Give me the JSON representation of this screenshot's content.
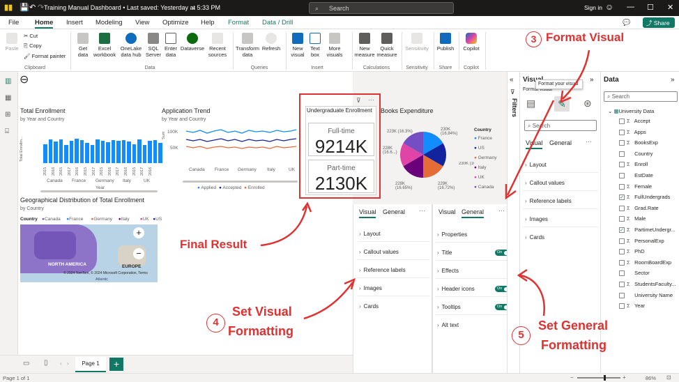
{
  "titlebar": {
    "title": "Training Manual Dashboard • Last saved: Yesterday at 5:33 PM",
    "search": "Search",
    "signin": "Sign in"
  },
  "menu": [
    "File",
    "Home",
    "Insert",
    "Modeling",
    "View",
    "Optimize",
    "Help",
    "Format",
    "Data / Drill"
  ],
  "share": "Share",
  "ribbon": {
    "clipboard": {
      "paste": "Paste",
      "cut": "Cut",
      "copy": "Copy",
      "format_painter": "Format painter",
      "label": "Clipboard"
    },
    "data": {
      "items": [
        "Get data",
        "Excel workbook",
        "OneLake data hub",
        "SQL Server",
        "Enter data",
        "Dataverse",
        "Recent sources"
      ],
      "label": "Data"
    },
    "queries": {
      "items": [
        "Transform data",
        "Refresh"
      ],
      "label": "Queries"
    },
    "insert": {
      "items": [
        "New visual",
        "Text box",
        "More visuals"
      ],
      "label": "Insert"
    },
    "calculations": {
      "items": [
        "New measure",
        "Quick measure"
      ],
      "label": "Calculations"
    },
    "sensitivity": {
      "items": [
        "Sensitivity"
      ],
      "label": "Sensitivity"
    },
    "share": {
      "items": [
        "Publish"
      ],
      "label": "Share"
    },
    "copilot": {
      "items": [
        "Copilot"
      ],
      "label": "Copilot"
    }
  },
  "visuals": {
    "enrollment": {
      "title": "Total Enrollment",
      "subtitle": "by Year and Country",
      "ylabel": "Total Enrollm...",
      "xlabel": "Year",
      "countries": [
        "Canada",
        "France",
        "Germany",
        "Italy",
        "UK"
      ],
      "years": [
        "2015",
        "2016",
        "2015",
        "2017",
        "2016",
        "2015",
        "2017",
        "2015",
        "2016",
        "2017",
        "2016",
        "2015",
        "2017",
        "2016"
      ]
    },
    "trend": {
      "title": "Application Trend",
      "subtitle": "by Year and Country",
      "ylabel": "Sum",
      "yticks": [
        "100K",
        "50K"
      ],
      "countries": [
        "Canada",
        "France",
        "Germany",
        "Italy",
        "UK"
      ],
      "legend": [
        "Applied",
        "Accepted",
        "Enrolled"
      ],
      "legend_colors": [
        "#118dff",
        "#12239e",
        "#e66c37"
      ]
    },
    "card": {
      "title": "Undergraduate Enrollment",
      "label1": "Full-time",
      "value1": "9214K",
      "label2": "Part-time",
      "value2": "2130K"
    },
    "books": {
      "title": "Books Expenditure",
      "legend_title": "Country",
      "legend": [
        "France",
        "US",
        "Germany",
        "Italy",
        "UK",
        "Canada"
      ],
      "legend_colors": [
        "#118dff",
        "#12239e",
        "#e66c37",
        "#6b007b",
        "#e044a7",
        "#744ec2"
      ],
      "labels": [
        "223K (16.3%)",
        "230K (16.84%)",
        "228K (16.6...)",
        "230K (16.…)",
        "228K (16.65%)",
        "229K (16.72%)"
      ]
    },
    "map": {
      "title": "Geographical Distribution of Total Enrollment",
      "subtitle": "by Country",
      "legend_title": "Country",
      "legend": [
        "Canada",
        "France",
        "Germany",
        "Italy",
        "UK",
        "US"
      ],
      "legend_colors": [
        "#744ec2",
        "#118dff",
        "#e66c37",
        "#6b007b",
        "#e044a7",
        "#12239e"
      ],
      "labels": [
        "NORTH AMERICA",
        "EUROPE",
        "Atlantic"
      ],
      "credit": "© 2024 TomTom, © 2024 Microsoft Corporation, Terms"
    }
  },
  "annotations": {
    "final": "Final Result",
    "step3_num": "3",
    "step3": "Format Visual",
    "step4_num": "4",
    "step4a": "Set Visual",
    "step4b": "Formatting",
    "step5_num": "5",
    "step5a": "Set General",
    "step5b": "Formatting"
  },
  "visual_pane_left": {
    "tabs": [
      "Visual",
      "General"
    ],
    "items": [
      "Layout",
      "Callout values",
      "Reference labels",
      "Images",
      "Cards"
    ]
  },
  "general_pane": {
    "tabs": [
      "Visual",
      "General"
    ],
    "items": [
      "Properties",
      "Title",
      "Effects",
      "Header icons",
      "Tooltips",
      "Alt text"
    ],
    "toggles": {
      "Title": "On",
      "Header icons": "On",
      "Tooltips": "On"
    }
  },
  "viz_pane": {
    "title": "Visual",
    "tooltip": "Format your visual",
    "subtitle": "Format visual",
    "search": "Search",
    "tabs": [
      "Visual",
      "General"
    ],
    "items": [
      "Layout",
      "Callout values",
      "Reference labels",
      "Images",
      "Cards"
    ]
  },
  "filters": "Filters",
  "data_pane": {
    "title": "Data",
    "search": "Search",
    "table": "University Data",
    "fields": [
      {
        "name": "Accept",
        "sigma": true,
        "checked": false
      },
      {
        "name": "Apps",
        "sigma": true,
        "checked": false
      },
      {
        "name": "BooksExp",
        "sigma": true,
        "checked": false
      },
      {
        "name": "Country",
        "sigma": false,
        "checked": false
      },
      {
        "name": "Enroll",
        "sigma": true,
        "checked": false
      },
      {
        "name": "EstDate",
        "sigma": false,
        "checked": false
      },
      {
        "name": "Female",
        "sigma": true,
        "checked": false
      },
      {
        "name": "FullUndergrads",
        "sigma": true,
        "checked": true
      },
      {
        "name": "Grad.Rate",
        "sigma": true,
        "checked": false
      },
      {
        "name": "Male",
        "sigma": true,
        "checked": false
      },
      {
        "name": "PartimeUndergr...",
        "sigma": true,
        "checked": true
      },
      {
        "name": "PersonalExp",
        "sigma": true,
        "checked": false
      },
      {
        "name": "PhD",
        "sigma": true,
        "checked": false
      },
      {
        "name": "RoomBoardExp",
        "sigma": true,
        "checked": false
      },
      {
        "name": "Sector",
        "sigma": false,
        "checked": false
      },
      {
        "name": "StudentsFaculty...",
        "sigma": true,
        "checked": false
      },
      {
        "name": "University Name",
        "sigma": false,
        "checked": false
      },
      {
        "name": "Year",
        "sigma": true,
        "checked": false
      }
    ]
  },
  "pages": {
    "page": "Page 1",
    "add": "+"
  },
  "status": {
    "left": "Page 1 of 1",
    "zoom": "86%"
  },
  "chart_data": {
    "type": "bar",
    "bar_values": [
      0.62,
      0.78,
      0.7,
      0.78,
      0.6,
      0.72,
      0.8,
      0.74,
      0.66,
      0.58,
      0.78,
      0.72,
      0.68,
      0.75,
      0.72,
      0.76,
      0.7,
      0.62,
      0.78,
      0.6,
      0.72,
      0.76,
      0.65
    ],
    "pie_values": [
      16.3,
      16.84,
      16.6,
      16.7,
      16.65,
      16.72
    ]
  }
}
